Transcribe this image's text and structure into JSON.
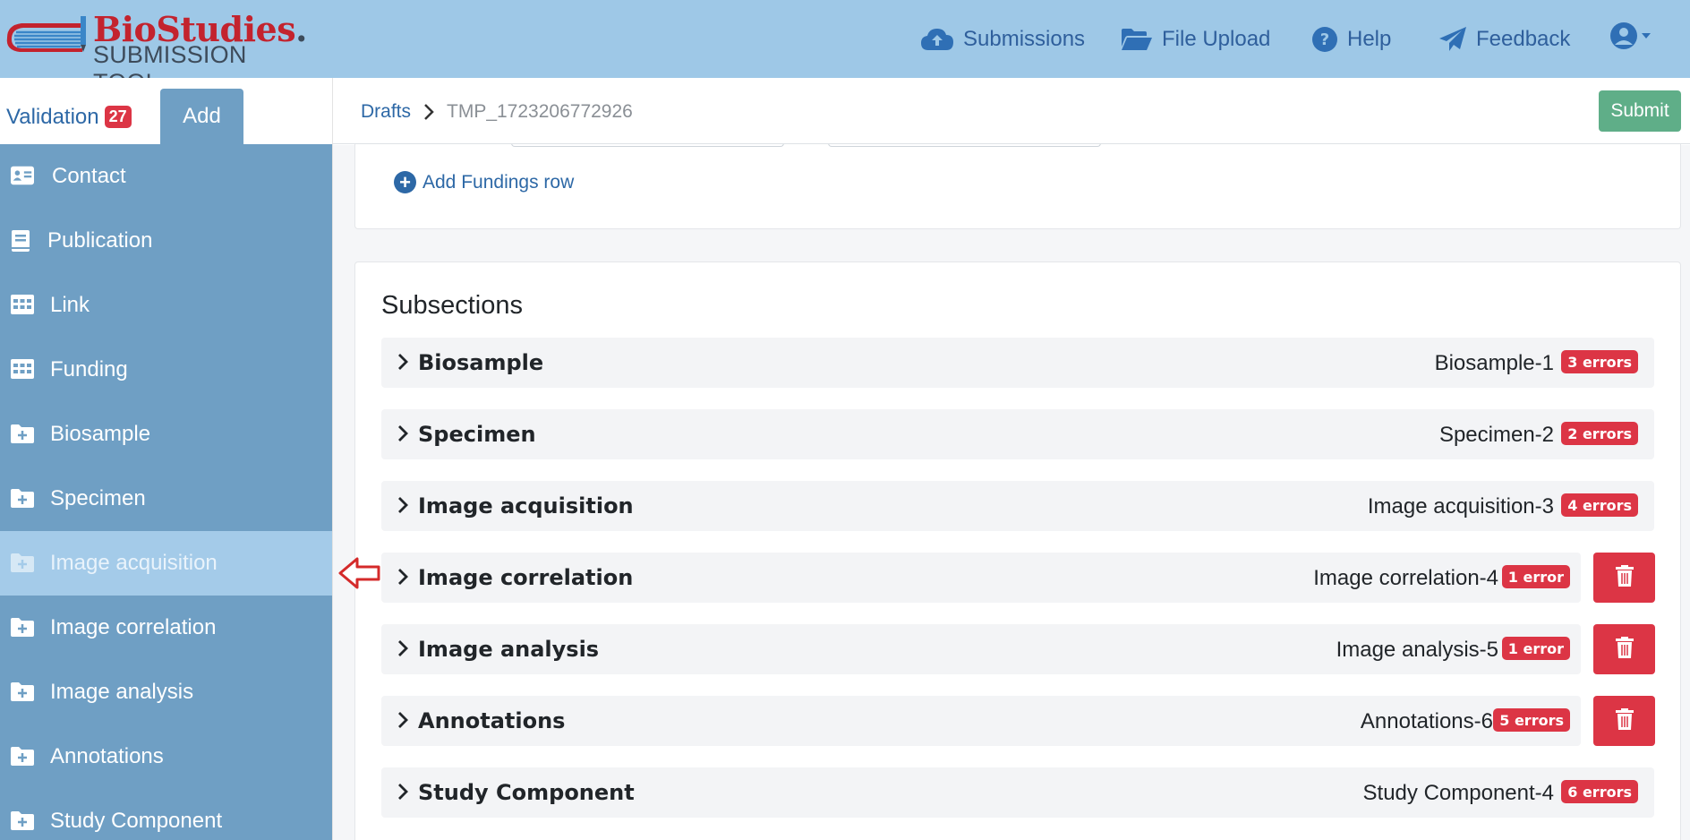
{
  "header": {
    "logo": {
      "brand": "BioStudies.",
      "brand_main": "BioStudies",
      "brand_dot": ".",
      "subtitle": "SUBMISSION TOOL"
    },
    "nav": [
      {
        "label": "Submissions",
        "icon": "cloud-upload-icon"
      },
      {
        "label": "File Upload",
        "icon": "folder-open-icon"
      },
      {
        "label": "Help",
        "icon": "question-circle-icon"
      },
      {
        "label": "Feedback",
        "icon": "paper-plane-icon"
      }
    ],
    "user_icon": "user-circle-icon"
  },
  "tabs": {
    "validation_label": "Validation",
    "validation_count": "27",
    "add_label": "Add"
  },
  "sidebar": {
    "items": [
      {
        "label": "Contact",
        "icon": "address-card-icon"
      },
      {
        "label": "Publication",
        "icon": "book-icon"
      },
      {
        "label": "Link",
        "icon": "table-icon"
      },
      {
        "label": "Funding",
        "icon": "table-icon"
      },
      {
        "label": "Biosample",
        "icon": "folder-plus-icon"
      },
      {
        "label": "Specimen",
        "icon": "folder-plus-icon"
      },
      {
        "label": "Image acquisition",
        "icon": "folder-plus-icon",
        "active": true
      },
      {
        "label": "Image correlation",
        "icon": "folder-plus-icon"
      },
      {
        "label": "Image analysis",
        "icon": "folder-plus-icon"
      },
      {
        "label": "Annotations",
        "icon": "folder-plus-icon"
      },
      {
        "label": "Study Component",
        "icon": "folder-plus-icon"
      }
    ]
  },
  "breadcrumb": {
    "root": "Drafts",
    "current": "TMP_1723206772926"
  },
  "submit_label": "Submit",
  "fundings": {
    "add_row_label": "Add Fundings row"
  },
  "subsections": {
    "title": "Subsections",
    "rows": [
      {
        "name": "Biosample",
        "value": "Biosample-1",
        "errors": "3 errors",
        "deletable": false
      },
      {
        "name": "Specimen",
        "value": "Specimen-2",
        "errors": "2 errors",
        "deletable": false
      },
      {
        "name": "Image acquisition",
        "value": "Image acquisition-3",
        "errors": "4 errors",
        "deletable": false
      },
      {
        "name": "Image correlation",
        "value": "Image correlation-4",
        "errors": "1 error",
        "deletable": true
      },
      {
        "name": "Image analysis",
        "value": "Image analysis-5",
        "errors": "1 error",
        "deletable": true
      },
      {
        "name": "Annotations",
        "value": "Annotations-6",
        "errors": "5 errors",
        "deletable": true
      },
      {
        "name": "Study Component",
        "value": "Study Component-4",
        "errors": "6 errors",
        "deletable": false
      }
    ]
  },
  "colors": {
    "header_bg": "#9ec8e7",
    "sidebar_bg": "#6f9fc4",
    "sidebar_active_bg": "#a4cbe9",
    "error_red": "#dc3545",
    "submit_green": "#5fae88",
    "link_blue": "#2d68a6"
  }
}
